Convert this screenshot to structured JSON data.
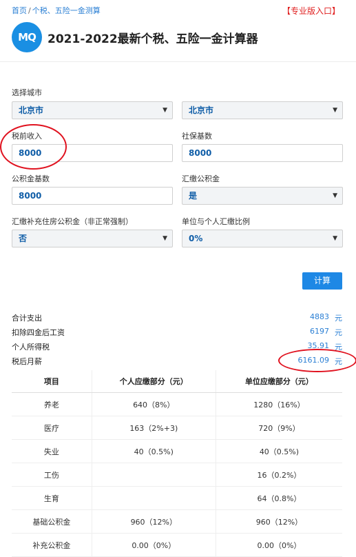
{
  "breadcrumb": {
    "home": "首页",
    "separator": "/",
    "current": "个税、五险一金测算"
  },
  "pro_link": "【专业版入口】",
  "logo_text": "MQ",
  "page_title": "2021-2022最新个税、五险一金计算器",
  "form": {
    "city_label": "选择城市",
    "city_province": "北京市",
    "city_city": "北京市",
    "pretax_label": "税前收入",
    "pretax_value": "8000",
    "social_base_label": "社保基数",
    "social_base_value": "8000",
    "fund_base_label": "公积金基数",
    "fund_base_value": "8000",
    "fund_pay_label": "汇缴公积金",
    "fund_pay_value": "是",
    "supp_fund_label": "汇缴补充住房公积金（非正常强制）",
    "supp_fund_value": "否",
    "ratio_label": "单位与个人汇缴比例",
    "ratio_value": "0%",
    "calc_button": "计算"
  },
  "summary": {
    "unit": "元",
    "rows": [
      {
        "label": "合计支出",
        "value": "4883"
      },
      {
        "label": "扣除四金后工资",
        "value": "6197"
      },
      {
        "label": "个人所得税",
        "value": "35.91"
      },
      {
        "label": "税后月薪",
        "value": "6161.09"
      }
    ]
  },
  "table": {
    "headers": [
      "项目",
      "个人应缴部分（元）",
      "单位应缴部分（元）"
    ],
    "rows": [
      [
        "养老",
        "640（8%）",
        "1280（16%）"
      ],
      [
        "医疗",
        "163（2%+3)",
        "720（9%）"
      ],
      [
        "失业",
        "40（0.5%)",
        "40（0.5%)"
      ],
      [
        "工伤",
        "",
        "16（0.2%）"
      ],
      [
        "生育",
        "",
        "64（0.8%）"
      ],
      [
        "基础公积金",
        "960（12%）",
        "960（12%）"
      ],
      [
        "补充公积金",
        "0.00（0%）",
        "0.00（0%）"
      ]
    ]
  },
  "annotation_color": "#e0121f",
  "accent_color": "#1e88e5"
}
